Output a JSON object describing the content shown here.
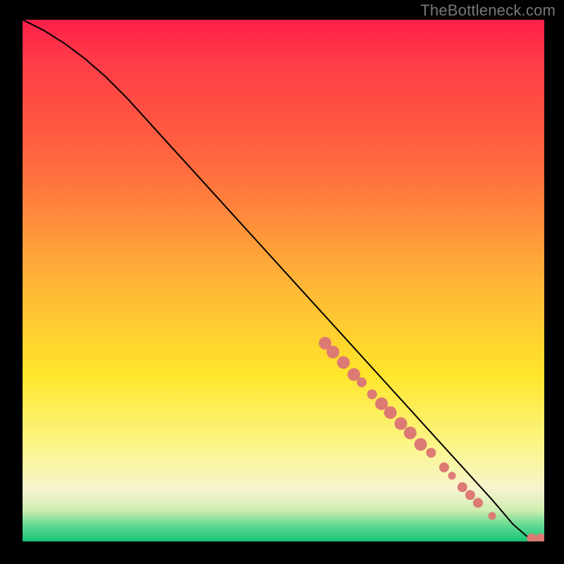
{
  "watermark": "TheBottleneck.com",
  "colors": {
    "curve": "#000000",
    "points": "#dd7a74",
    "black_border": "#000000"
  },
  "chart_data": {
    "type": "line",
    "title": "",
    "xlabel": "",
    "ylabel": "",
    "xlim": [
      0,
      100
    ],
    "ylim": [
      0,
      100
    ],
    "legend": false,
    "grid": false,
    "curve": {
      "description": "Monotone decreasing curve from top-left corner to bottom-right, short flat tail at the bottom",
      "x": [
        0,
        4,
        8,
        12,
        16,
        20,
        25,
        30,
        35,
        40,
        45,
        50,
        55,
        60,
        65,
        70,
        75,
        80,
        85,
        90,
        94,
        97,
        100
      ],
      "y": [
        100,
        98,
        95.5,
        92.5,
        89,
        85,
        79.5,
        74,
        68.5,
        63,
        57.5,
        52,
        46.5,
        41,
        35.5,
        30,
        24.5,
        19,
        13.5,
        8,
        3.3,
        0.7,
        0.6
      ]
    },
    "scatter_points_on_curve": [
      {
        "x": 58,
        "y": 38.0,
        "size": "lg"
      },
      {
        "x": 59.5,
        "y": 36.3,
        "size": "lg"
      },
      {
        "x": 61.5,
        "y": 34.3,
        "size": "lg"
      },
      {
        "x": 63.5,
        "y": 32.0,
        "size": "lg"
      },
      {
        "x": 65.0,
        "y": 30.5,
        "size": "md"
      },
      {
        "x": 67.0,
        "y": 28.2,
        "size": "md"
      },
      {
        "x": 68.8,
        "y": 26.4,
        "size": "lg"
      },
      {
        "x": 70.5,
        "y": 24.7,
        "size": "lg"
      },
      {
        "x": 72.5,
        "y": 22.6,
        "size": "lg"
      },
      {
        "x": 74.3,
        "y": 20.8,
        "size": "lg"
      },
      {
        "x": 76.3,
        "y": 18.6,
        "size": "lg"
      },
      {
        "x": 78.3,
        "y": 17.0,
        "size": "md"
      },
      {
        "x": 80.8,
        "y": 14.2,
        "size": "md"
      },
      {
        "x": 82.3,
        "y": 12.6,
        "size": "sm"
      },
      {
        "x": 84.3,
        "y": 10.4,
        "size": "md"
      },
      {
        "x": 85.8,
        "y": 8.9,
        "size": "md"
      },
      {
        "x": 87.3,
        "y": 7.4,
        "size": "md"
      },
      {
        "x": 90.0,
        "y": 4.9,
        "size": "sm"
      },
      {
        "x": 97.6,
        "y": 0.6,
        "size": "md"
      },
      {
        "x": 99.3,
        "y": 0.6,
        "size": "md"
      }
    ]
  }
}
